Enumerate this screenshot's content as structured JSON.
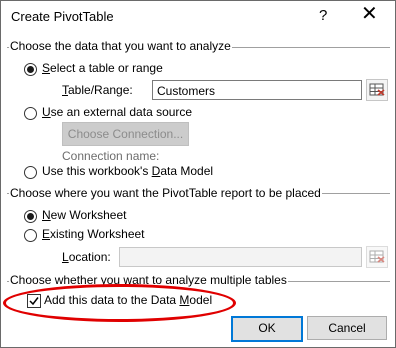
{
  "window": {
    "title": "Create PivotTable",
    "help_glyph": "?",
    "close_glyph": "✕"
  },
  "section1": {
    "heading": "Choose the data that you want to analyze",
    "select_table": {
      "pre": "",
      "ul": "S",
      "post": "elect a table or range",
      "selected": true
    },
    "table_range": {
      "ul": "T",
      "post": "able/Range:",
      "value": "Customers"
    },
    "external": {
      "pre": "",
      "ul": "U",
      "post": "se an external data source",
      "selected": false
    },
    "choose_connection": "Choose Connection...",
    "connection_name": "Connection name:",
    "data_model": {
      "pre": "Use this workbook's ",
      "ul": "D",
      "post": "ata Model",
      "selected": false
    }
  },
  "section2": {
    "heading": "Choose where you want the PivotTable report to be placed",
    "new_ws": {
      "ul": "N",
      "post": "ew Worksheet",
      "selected": true
    },
    "existing_ws": {
      "ul": "E",
      "post": "xisting Worksheet",
      "selected": false
    },
    "location": {
      "ul": "L",
      "post": "ocation:",
      "value": ""
    }
  },
  "section3": {
    "heading": "Choose whether you want to analyze multiple tables",
    "add_model": {
      "pre": "Add this data to the Data ",
      "ul": "M",
      "post": "odel",
      "checked": true
    }
  },
  "buttons": {
    "ok": "OK",
    "cancel": "Cancel"
  },
  "colors": {
    "annotation": "#e00000",
    "focus_border": "#0078d7"
  }
}
